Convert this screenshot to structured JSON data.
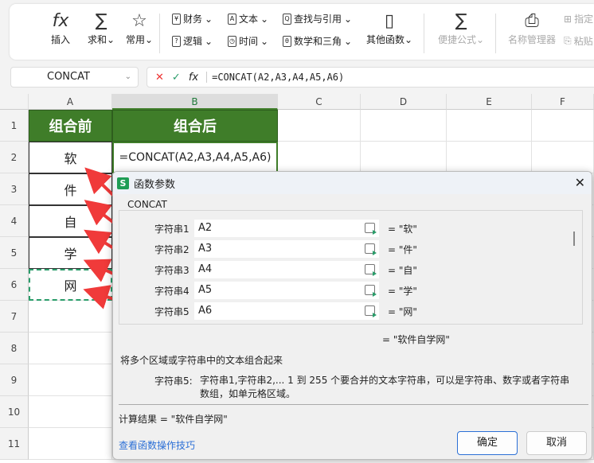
{
  "ribbon": {
    "insert": "插入",
    "sum": "求和",
    "common": "常用",
    "finance": "财务",
    "text": "文本",
    "lookup": "查找与引用",
    "logic": "逻辑",
    "time": "时间",
    "math": "数学和三角",
    "other": "其他函数",
    "quick": "便捷公式",
    "name_mgr": "名称管理器",
    "specify": "指定",
    "paste": "粘贴"
  },
  "formula_bar": {
    "name_box": "CONCAT",
    "formula": "=CONCAT(A2,A3,A4,A5,A6)"
  },
  "columns": [
    "A",
    "B",
    "C",
    "D",
    "E",
    "F"
  ],
  "rows": [
    "1",
    "2",
    "3",
    "4",
    "5",
    "6",
    "7",
    "8",
    "9",
    "10",
    "11"
  ],
  "cells": {
    "A1": "组合前",
    "B1": "组合后",
    "B2": "=CONCAT(A2,A3,A4,A5,A6)",
    "A2": "软",
    "A3": "件",
    "A4": "自",
    "A5": "学",
    "A6": "网"
  },
  "dialog": {
    "title": "函数参数",
    "function": "CONCAT",
    "params": [
      {
        "label": "字符串1",
        "value": "A2",
        "result": "= \"软\""
      },
      {
        "label": "字符串2",
        "value": "A3",
        "result": "= \"件\""
      },
      {
        "label": "字符串3",
        "value": "A4",
        "result": "= \"自\""
      },
      {
        "label": "字符串4",
        "value": "A5",
        "result": "= \"学\""
      },
      {
        "label": "字符串5",
        "value": "A6",
        "result": "= \"网\""
      }
    ],
    "overall_result": "= \"软件自学网\"",
    "description": "将多个区域或字符串中的文本组合起来",
    "param_name": "字符串5:",
    "param_desc": "字符串1,字符串2,... 1 到 255 个要合并的文本字符串，可以是字符串、数字或者字符串数组，如单元格区域。",
    "calc_result": "计算结果 = \"软件自学网\"",
    "help_link": "查看函数操作技巧",
    "ok": "确定",
    "cancel": "取消"
  }
}
